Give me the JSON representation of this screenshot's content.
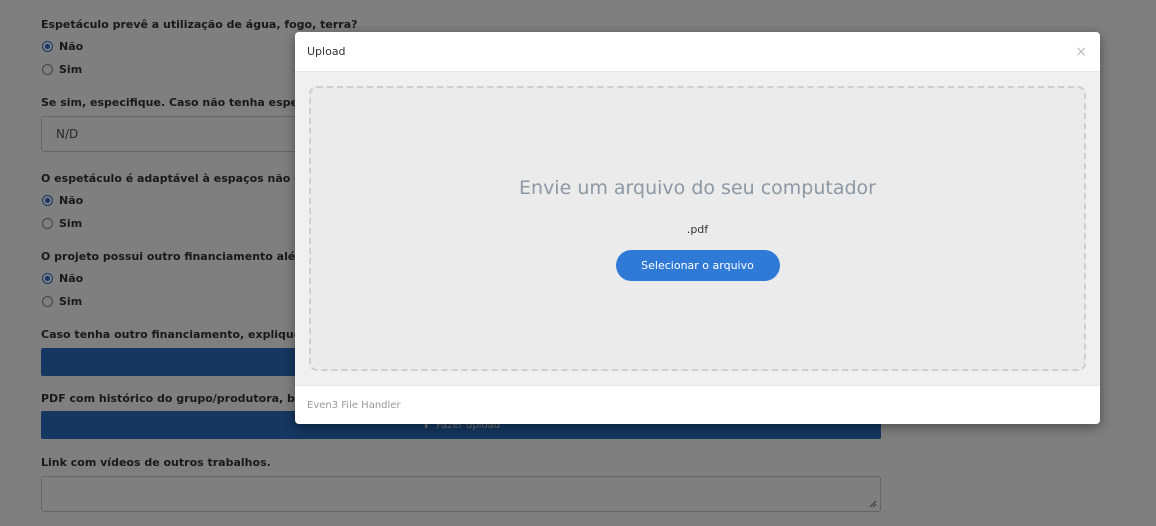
{
  "form": {
    "q1": "Espetáculo prevê a utilização de água, fogo, terra?",
    "q1_opt_no": "Não",
    "q1_opt_yes": "Sim",
    "q2": "Se sim, especifique. Caso não tenha especifica",
    "q2_value": "N/D",
    "q3": "O espetáculo é adaptável à espaços não conv",
    "q3_opt_no": "Não",
    "q3_opt_yes": "Sim",
    "q4": "O projeto possui outro financiamento além d",
    "q4_opt_no": "Não",
    "q4_opt_yes": "Sim",
    "q5": "Caso tenha outro financiamento, explique qu",
    "q6": "PDF com histórico do grupo/produtora, breve",
    "upload_label": "Fazer upload",
    "q7": "Link com vídeos de outros trabalhos."
  },
  "modal": {
    "title": "Upload",
    "close": "×",
    "dropzone_title": "Envie um arquivo do seu computador",
    "extension": ".pdf",
    "select_button": "Selecionar o arquivo",
    "footer": "Even3 File Handler"
  },
  "colors": {
    "accent": "#2f7ad6",
    "overlay": "rgba(0,0,0,0.5)"
  }
}
